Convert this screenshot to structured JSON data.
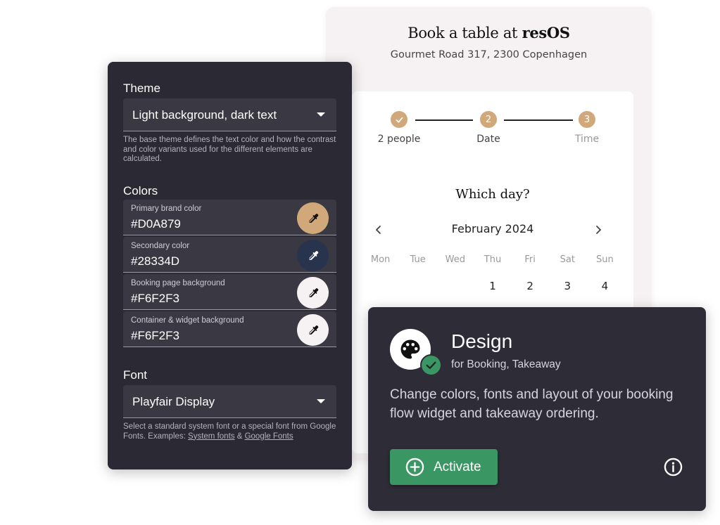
{
  "booking_page": {
    "title_prefix": "Book a table at ",
    "title_brand": "resOS",
    "address": "Gourmet Road 317, 2300 Copenhagen",
    "steps": [
      {
        "label": "2 people",
        "state": "done",
        "number": ""
      },
      {
        "label": "Date",
        "state": "current",
        "number": "2"
      },
      {
        "label": "Time",
        "state": "upcoming",
        "number": "3"
      }
    ],
    "question": "Which day?",
    "month": "February 2024",
    "prev_icon": "chevron-left-icon",
    "next_icon": "chevron-right-icon",
    "weekdays": [
      "Mon",
      "Tue",
      "Wed",
      "Thu",
      "Fri",
      "Sat",
      "Sun"
    ],
    "first_week": [
      "",
      "",
      "",
      "1",
      "2",
      "3",
      "4"
    ]
  },
  "settings": {
    "theme": {
      "title": "Theme",
      "value": "Light background, dark text",
      "helper": "The base theme defines the text color and how the contrast and color variants used for the different elements are calculated."
    },
    "colors": {
      "title": "Colors",
      "fields": [
        {
          "label": "Primary brand color",
          "value": "#D0A879",
          "swatch": "#D0A879"
        },
        {
          "label": "Secondary color",
          "value": "#28334D",
          "swatch": "#28334D"
        },
        {
          "label": "Booking page background",
          "value": "#F6F2F3",
          "swatch": "#F6F2F3"
        },
        {
          "label": "Container & widget background",
          "value": "#F6F2F3",
          "swatch": "#F6F2F3"
        }
      ]
    },
    "font": {
      "title": "Font",
      "value": "Playfair Display",
      "helper_prefix": "Select a standard system font or a special font from Google Fonts. Examples: ",
      "link_system": "System fonts",
      "link_sep": " & ",
      "link_google": "Google Fonts"
    }
  },
  "design_card": {
    "title": "Design",
    "subtitle": "for Booking, Takeaway",
    "description": "Change colors, fonts and layout of your booking flow widget and takeaway ordering.",
    "activate_label": "Activate",
    "accent": "#3A9663",
    "brand": "#D0A879"
  }
}
